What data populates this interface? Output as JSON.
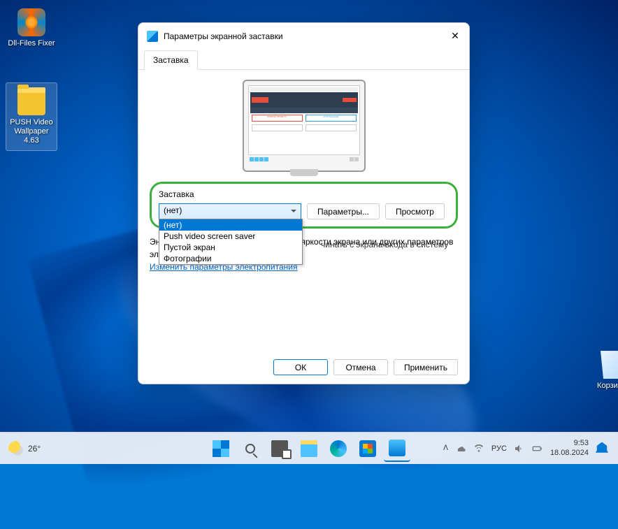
{
  "desktop": {
    "icons": [
      {
        "name": "dll-files-fixer",
        "label": "Dll-Files Fixer"
      },
      {
        "name": "push-video-wallpaper",
        "label": "PUSH Video Wallpaper 4.63"
      },
      {
        "name": "recycle-bin",
        "label": "Корзина"
      }
    ]
  },
  "dialog": {
    "title": "Параметры экранной заставки",
    "tab": "Заставка",
    "section_label": "Заставка",
    "combo_value": "(нет)",
    "options": [
      "(нет)",
      "Push video screen saver",
      "Пустой экран",
      "Фотографии"
    ],
    "selected_option": "(нет)",
    "btn_params": "Параметры...",
    "btn_preview": "Просмотр",
    "login_text": "чинать с экрана входа в систему",
    "energy_heading": "Энергосбережение за счет изменения яркости экрана или других параметров электропитания.",
    "energy_link": "Изменить параметры электропитания",
    "btn_ok": "ОК",
    "btn_cancel": "Отмена",
    "btn_apply": "Применить"
  },
  "taskbar": {
    "weather_temp": "26°",
    "lang": "РУС",
    "time": "9:53",
    "date": "18.08.2024"
  }
}
